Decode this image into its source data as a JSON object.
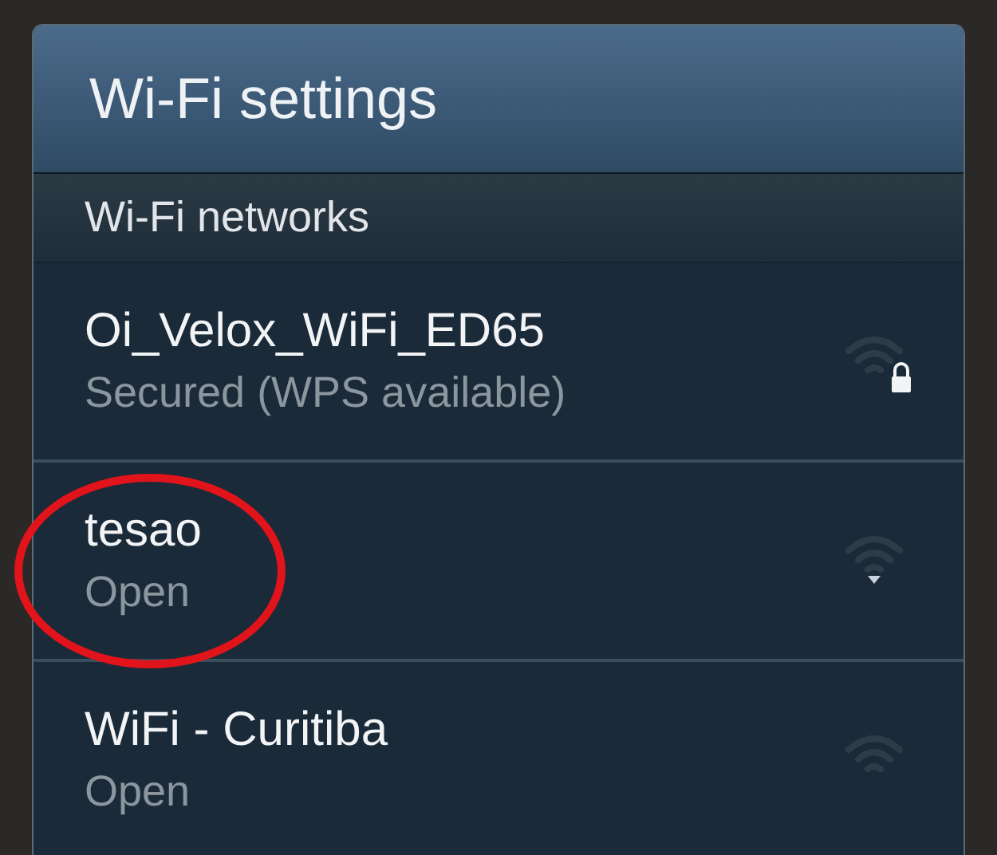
{
  "title": "Wi-Fi settings",
  "section": "Wi-Fi networks",
  "networks": [
    {
      "name": "Oi_Velox_WiFi_ED65",
      "status": "Secured (WPS available)",
      "kind": "locked",
      "circled": false
    },
    {
      "name": "tesao",
      "status": "Open",
      "kind": "arrow",
      "circled": true
    },
    {
      "name": "WiFi - Curitiba",
      "status": "Open",
      "kind": "plain",
      "circled": false
    }
  ]
}
